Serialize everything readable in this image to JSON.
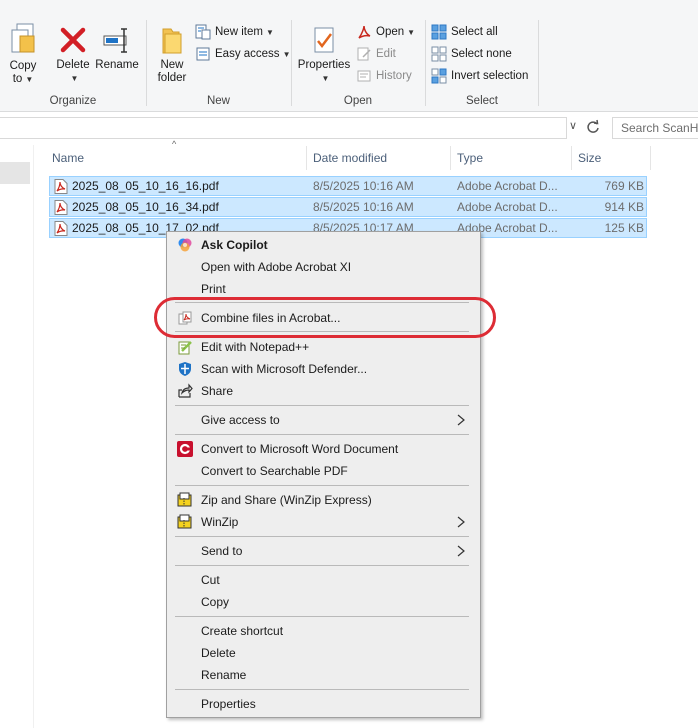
{
  "ribbon": {
    "organize": {
      "title": "Organize",
      "copy_to": "Copy",
      "copy_to_2": "to",
      "delete": "Delete",
      "rename": "Rename"
    },
    "new": {
      "title": "New",
      "new_folder_1": "New",
      "new_folder_2": "folder",
      "new_item": "New item",
      "easy_access": "Easy access"
    },
    "open": {
      "title": "Open",
      "properties": "Properties",
      "open": "Open",
      "edit": "Edit",
      "history": "History"
    },
    "select": {
      "title": "Select",
      "select_all": "Select all",
      "select_none": "Select none",
      "invert": "Invert selection"
    }
  },
  "search": {
    "placeholder": "Search ScanHe"
  },
  "columns": {
    "name": "Name",
    "date": "Date modified",
    "type": "Type",
    "size": "Size"
  },
  "files": [
    {
      "name": "2025_08_05_10_16_16.pdf",
      "date": "8/5/2025 10:16 AM",
      "type": "Adobe Acrobat D...",
      "size": "769 KB"
    },
    {
      "name": "2025_08_05_10_16_34.pdf",
      "date": "8/5/2025 10:16 AM",
      "type": "Adobe Acrobat D...",
      "size": "914 KB"
    },
    {
      "name": "2025_08_05_10_17_02.pdf",
      "date": "8/5/2025 10:17 AM",
      "type": "Adobe Acrobat D...",
      "size": "125 KB"
    }
  ],
  "menu": {
    "ask_copilot": "Ask Copilot",
    "open_with_acrobat": "Open with Adobe Acrobat XI",
    "print": "Print",
    "combine": "Combine files in Acrobat...",
    "edit_notepad": "Edit with Notepad++",
    "scan_defender": "Scan with Microsoft Defender...",
    "share": "Share",
    "give_access": "Give access to",
    "convert_word": "Convert to Microsoft Word Document",
    "convert_pdf": "Convert to Searchable PDF",
    "zip_share": "Zip and Share (WinZip Express)",
    "winzip": "WinZip",
    "send_to": "Send to",
    "cut": "Cut",
    "copy": "Copy",
    "create_shortcut": "Create shortcut",
    "delete": "Delete",
    "rename": "Rename",
    "properties": "Properties"
  },
  "colors": {
    "selection": "#cce8ff",
    "selection_border": "#99d1ff",
    "highlight_ring": "#dd2c35",
    "menu_bg": "#eeeeee"
  }
}
